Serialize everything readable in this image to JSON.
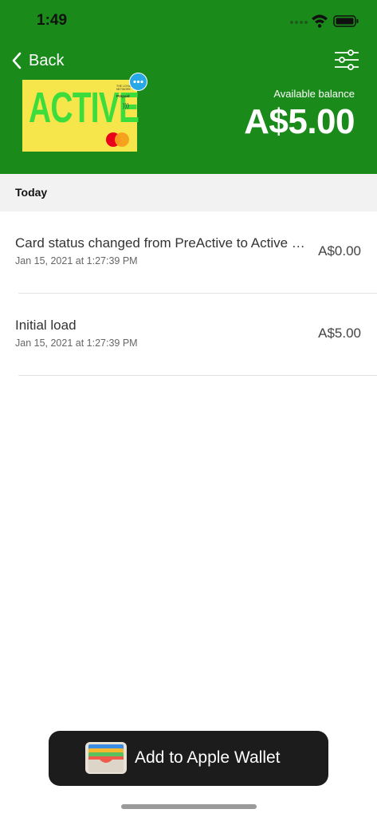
{
  "status_bar": {
    "time": "1:49"
  },
  "nav": {
    "back_label": "Back"
  },
  "card": {
    "word": "ACTIVE",
    "small_text": "THE LOYAL NETWORK",
    "prepaid_label": "Prepaid",
    "brand_colors": {
      "card": "#f6e64b",
      "text": "#3bdc3b"
    }
  },
  "balance": {
    "label": "Available balance",
    "amount": "A$5.00"
  },
  "section": {
    "label": "Today"
  },
  "transactions": [
    {
      "title": "Card status changed from PreActive to Active d...",
      "date": "Jan 15, 2021 at 1:27:39 PM",
      "amount": "A$0.00"
    },
    {
      "title": "Initial load",
      "date": "Jan 15, 2021 at 1:27:39 PM",
      "amount": "A$5.00"
    }
  ],
  "wallet": {
    "label": "Add to Apple Wallet"
  },
  "colors": {
    "header": "#1a8a1a",
    "accent": "#29a8e8",
    "button": "#1c1c1c"
  },
  "icons": [
    "back-chevron-icon",
    "filter-sliders-icon",
    "more-dots-icon",
    "wifi-icon",
    "battery-icon",
    "signal-icon",
    "wallet-icon",
    "contactless-icon",
    "mastercard-logo"
  ]
}
